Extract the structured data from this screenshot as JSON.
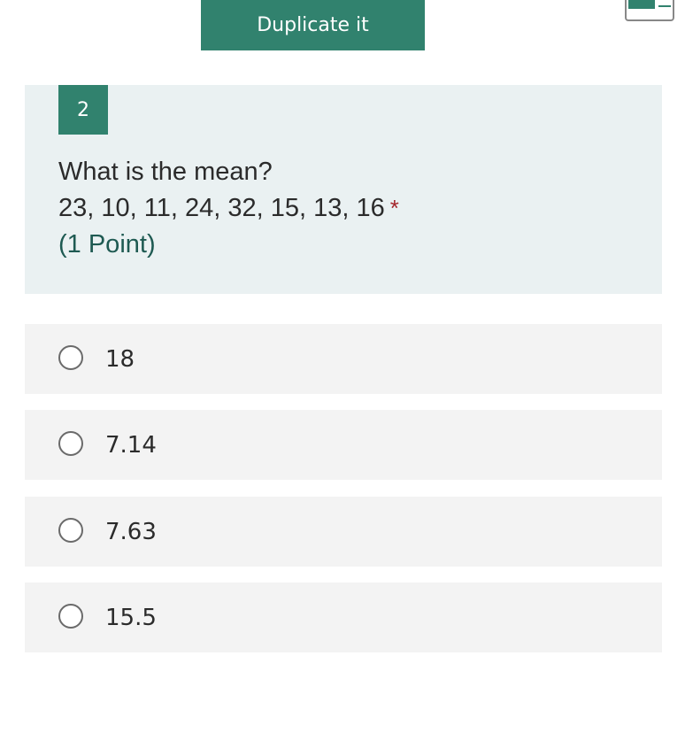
{
  "header": {
    "duplicate_label": "Duplicate it"
  },
  "question": {
    "number": "2",
    "title_line1": "What is the mean?",
    "title_line2": "23, 10, 11, 24, 32, 15, 13, 16",
    "required_mark": "*",
    "points": "(1 Point)"
  },
  "options": [
    {
      "label": "18"
    },
    {
      "label": "7.14"
    },
    {
      "label": "7.63"
    },
    {
      "label": "15.5"
    }
  ],
  "colors": {
    "accent": "#31826e",
    "question_bg": "#eaf1f2",
    "option_bg": "#f3f3f3",
    "required": "#a4262c"
  }
}
